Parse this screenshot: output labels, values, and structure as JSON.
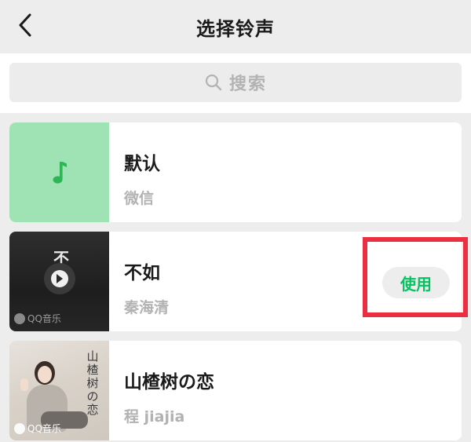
{
  "header": {
    "title": "选择铃声"
  },
  "search": {
    "placeholder": "搜索"
  },
  "ringtones": [
    {
      "name": "默认",
      "artist": "微信"
    },
    {
      "name": "不如",
      "artist": "秦海清",
      "cover_title": "不",
      "cover_brand": "QQ音乐",
      "action_label": "使用"
    },
    {
      "name": "山楂树の恋",
      "artist": "程 jiajia",
      "cover_title": "山楂树の恋",
      "cover_brand": "QQ音乐"
    }
  ],
  "colors": {
    "accent": "#07c160",
    "highlight": "#ec2f40",
    "default_cover": "#9fe3b4"
  },
  "icons": {
    "back": "chevron-left-icon",
    "search": "search-icon",
    "music_note": "music-note-icon",
    "play": "play-icon"
  }
}
